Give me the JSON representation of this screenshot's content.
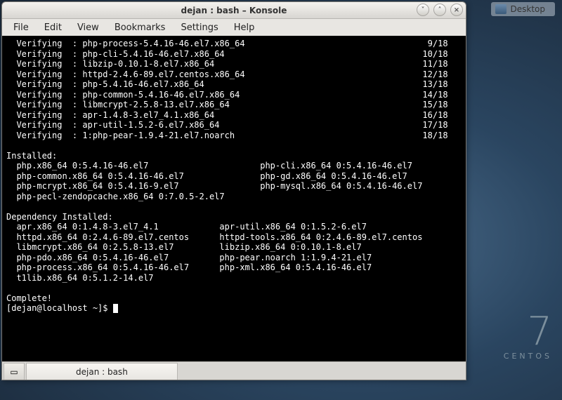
{
  "desktop": {
    "label": "Desktop"
  },
  "window": {
    "title": "dejan : bash – Konsole",
    "menus": [
      "File",
      "Edit",
      "View",
      "Bookmarks",
      "Settings",
      "Help"
    ],
    "tab_label": "dejan : bash",
    "prompt": "[dejan@localhost ~]$ "
  },
  "verifying": [
    {
      "pkg": "php-process-5.4.16-46.el7.x86_64",
      "n": "9/18"
    },
    {
      "pkg": "php-cli-5.4.16-46.el7.x86_64",
      "n": "10/18"
    },
    {
      "pkg": "libzip-0.10.1-8.el7.x86_64",
      "n": "11/18"
    },
    {
      "pkg": "httpd-2.4.6-89.el7.centos.x86_64",
      "n": "12/18"
    },
    {
      "pkg": "php-5.4.16-46.el7.x86_64",
      "n": "13/18"
    },
    {
      "pkg": "php-common-5.4.16-46.el7.x86_64",
      "n": "14/18"
    },
    {
      "pkg": "libmcrypt-2.5.8-13.el7.x86_64",
      "n": "15/18"
    },
    {
      "pkg": "apr-1.4.8-3.el7_4.1.x86_64",
      "n": "16/18"
    },
    {
      "pkg": "apr-util-1.5.2-6.el7.x86_64",
      "n": "17/18"
    },
    {
      "pkg": "1:php-pear-1.9.4-21.el7.noarch",
      "n": "18/18"
    }
  ],
  "installed_header": "Installed:",
  "installed": [
    [
      "php.x86_64 0:5.4.16-46.el7",
      "php-cli.x86_64 0:5.4.16-46.el7"
    ],
    [
      "php-common.x86_64 0:5.4.16-46.el7",
      "php-gd.x86_64 0:5.4.16-46.el7"
    ],
    [
      "php-mcrypt.x86_64 0:5.4.16-9.el7",
      "php-mysql.x86_64 0:5.4.16-46.el7"
    ],
    [
      "php-pecl-zendopcache.x86_64 0:7.0.5-2.el7",
      ""
    ]
  ],
  "dep_header": "Dependency Installed:",
  "deps": [
    [
      "apr.x86_64 0:1.4.8-3.el7_4.1",
      "apr-util.x86_64 0:1.5.2-6.el7"
    ],
    [
      "httpd.x86_64 0:2.4.6-89.el7.centos",
      "httpd-tools.x86_64 0:2.4.6-89.el7.centos"
    ],
    [
      "libmcrypt.x86_64 0:2.5.8-13.el7",
      "libzip.x86_64 0:0.10.1-8.el7"
    ],
    [
      "php-pdo.x86_64 0:5.4.16-46.el7",
      "php-pear.noarch 1:1.9.4-21.el7"
    ],
    [
      "php-process.x86_64 0:5.4.16-46.el7",
      "php-xml.x86_64 0:5.4.16-46.el7"
    ],
    [
      "t1lib.x86_64 0:5.1.2-14.el7",
      ""
    ]
  ],
  "complete": "Complete!",
  "brand": {
    "seven": "7",
    "name": "CENTOS"
  }
}
